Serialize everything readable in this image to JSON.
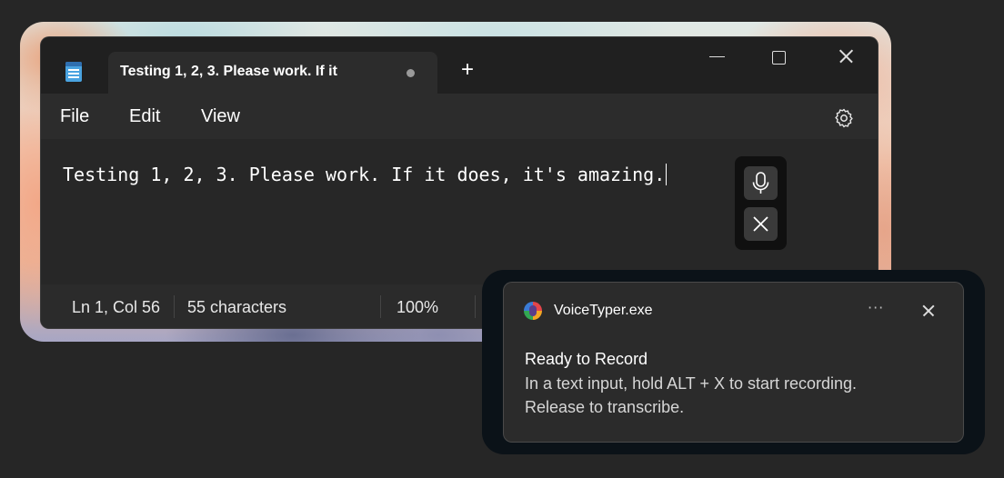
{
  "window": {
    "tab_title": "Testing 1, 2, 3. Please work. If it",
    "new_tab_label": "+"
  },
  "menu": {
    "file": "File",
    "edit": "Edit",
    "view": "View"
  },
  "editor": {
    "text": "Testing 1, 2, 3. Please work. If it does, it's amazing."
  },
  "statusbar": {
    "position": "Ln 1, Col 56",
    "char_count": "55 characters",
    "zoom": "100%"
  },
  "notification": {
    "app_name": "VoiceTyper.exe",
    "more_label": "···",
    "title": "Ready to Record",
    "line1": "In a text input, hold ALT + X to start recording.",
    "line2": "Release to transcribe."
  },
  "icons": {
    "app": "notepad-icon",
    "settings": "gear-icon",
    "mic": "microphone-icon",
    "stop": "close-icon",
    "notification_app": "voicetyper-logo-icon"
  }
}
